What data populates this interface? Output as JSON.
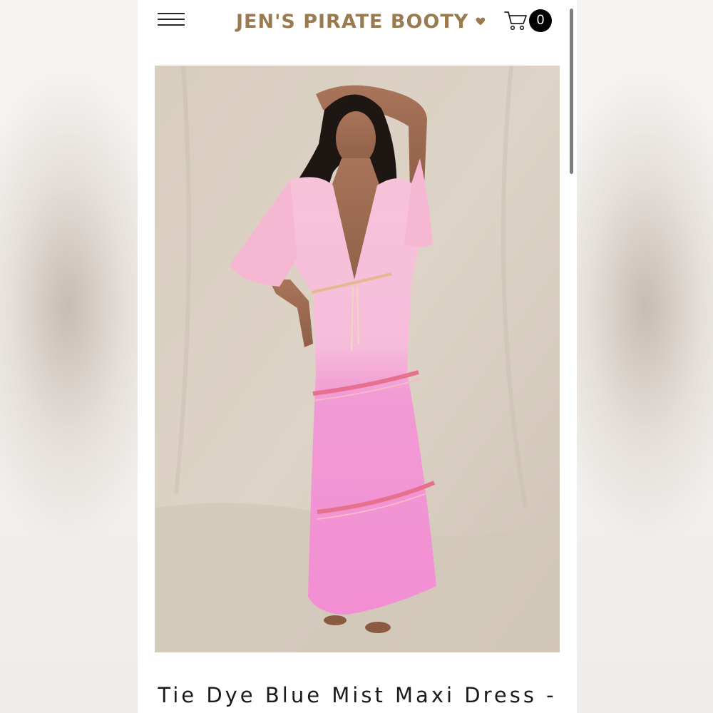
{
  "header": {
    "menu_icon": "hamburger-menu-icon",
    "brand_name": "JEN'S PIRATE BOOTY",
    "brand_heart_icon": "heart-icon",
    "cart_icon": "shopping-cart-icon",
    "cart_count": "0"
  },
  "product": {
    "image_alt": "Model wearing pink tie dye maxi dress",
    "title": "Tie Dye Blue Mist Maxi Dress -"
  },
  "colors": {
    "brand": "#9a7a50",
    "dress_pink": "#f59fd4",
    "backdrop": "#d9cfc2",
    "badge": "#000000"
  }
}
